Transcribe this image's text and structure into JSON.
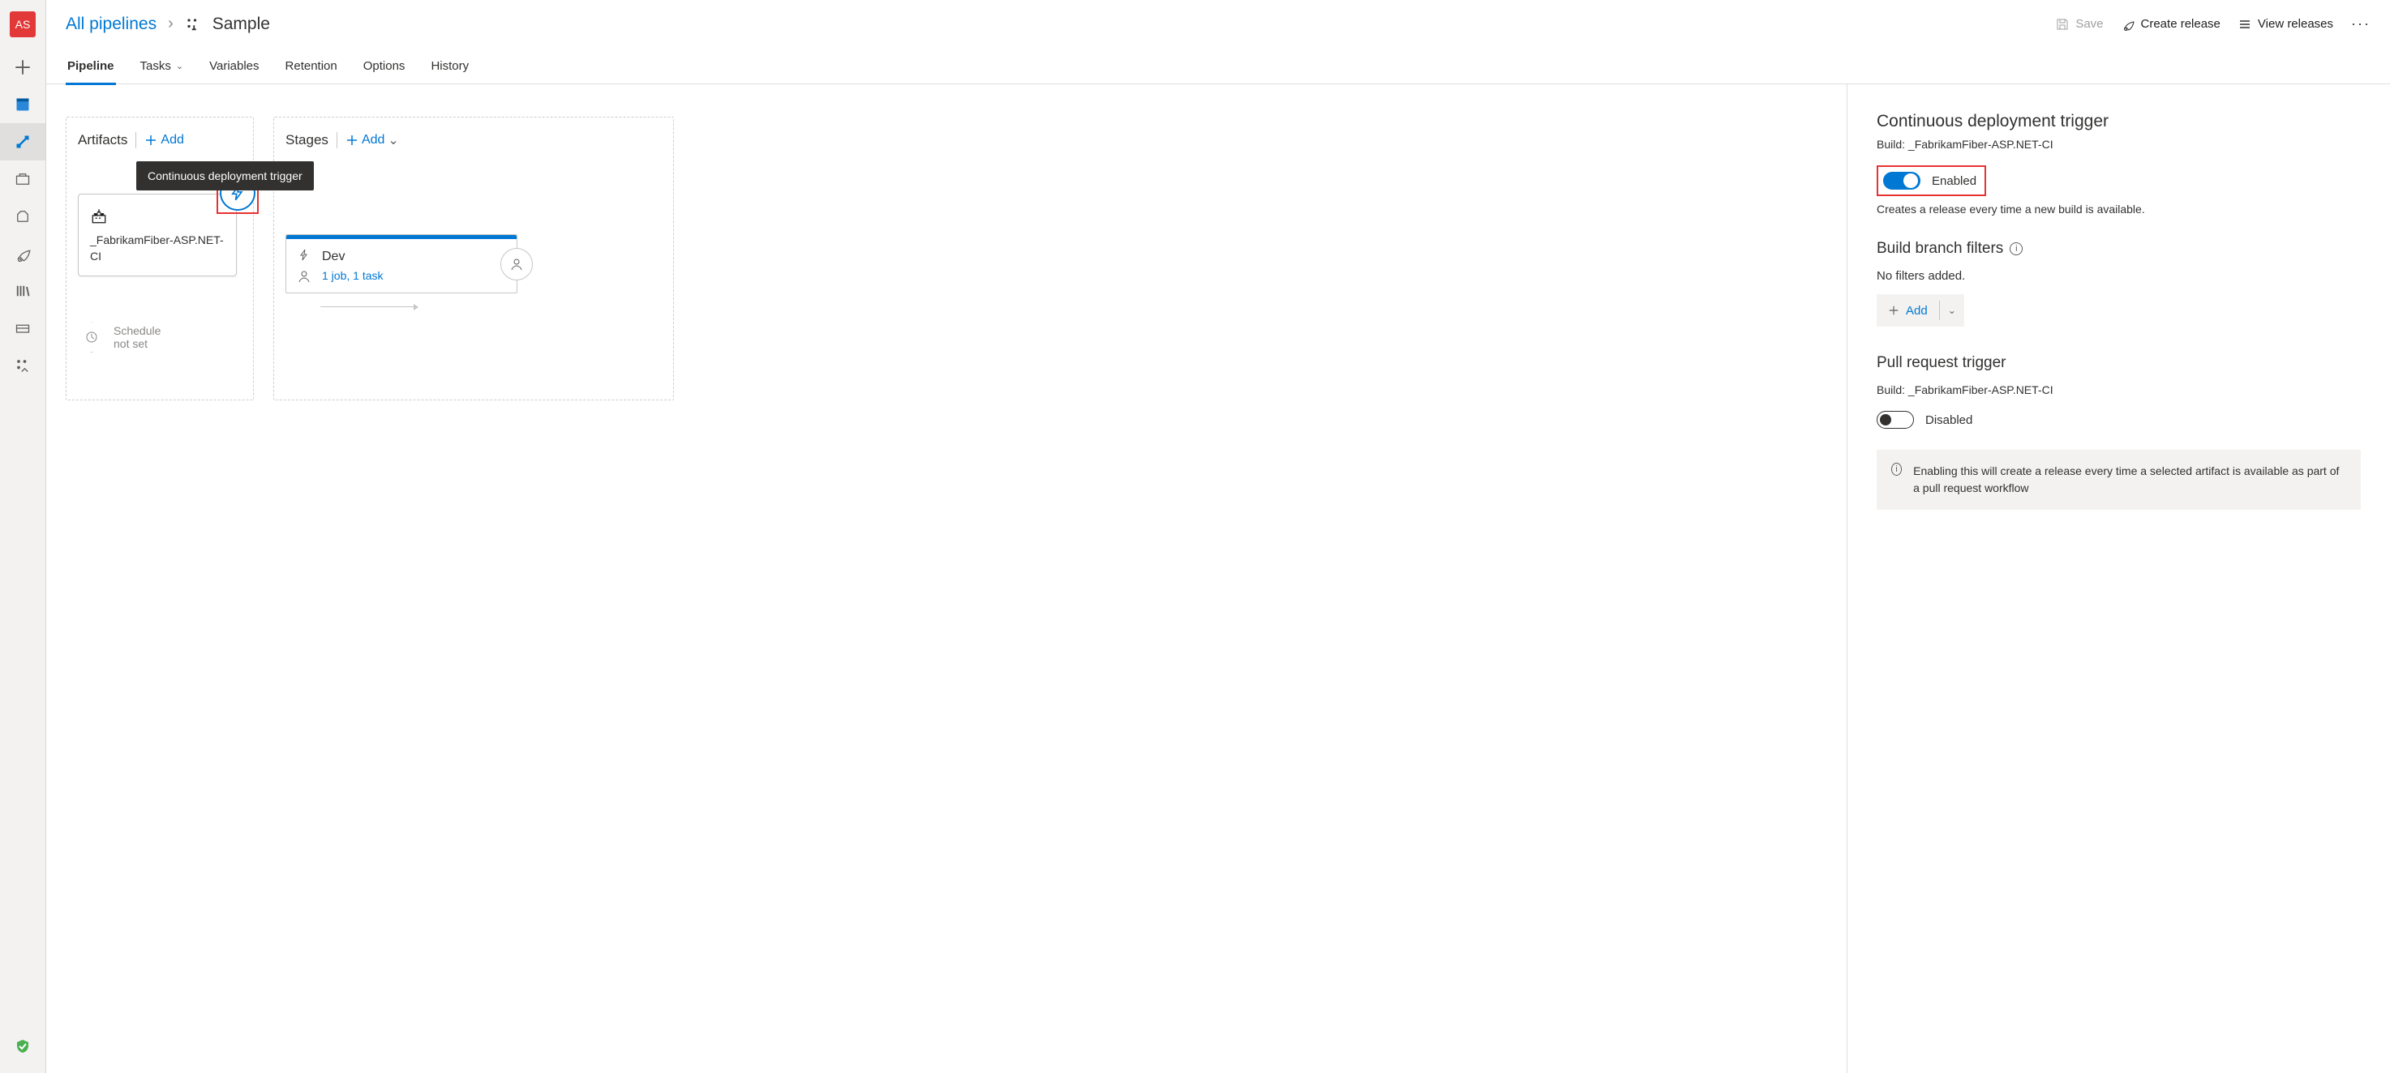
{
  "avatar": "AS",
  "breadcrumb": {
    "root": "All pipelines",
    "title": "Sample"
  },
  "headerActions": {
    "save": "Save",
    "createRelease": "Create release",
    "viewReleases": "View releases"
  },
  "tabs": {
    "pipeline": "Pipeline",
    "tasks": "Tasks",
    "variables": "Variables",
    "retention": "Retention",
    "options": "Options",
    "history": "History"
  },
  "canvas": {
    "artifactsTitle": "Artifacts",
    "stagesTitle": "Stages",
    "addLabel": "Add",
    "tooltip": "Continuous deployment trigger",
    "artifactName": "_FabrikamFiber-ASP.NET-CI",
    "scheduleText": "Schedule not set",
    "stageName": "Dev",
    "stageSub": "1 job, 1 task"
  },
  "panel": {
    "cdTitle": "Continuous deployment trigger",
    "buildLabel": "Build: _FabrikamFiber-ASP.NET-CI",
    "enabledLabel": "Enabled",
    "cdDesc": "Creates a release every time a new build is available.",
    "filtersTitle": "Build branch filters",
    "noFilters": "No filters added.",
    "addLabel": "Add",
    "prTitle": "Pull request trigger",
    "disabledLabel": "Disabled",
    "prInfo": "Enabling this will create a release every time a selected artifact is available as part of a pull request workflow"
  }
}
